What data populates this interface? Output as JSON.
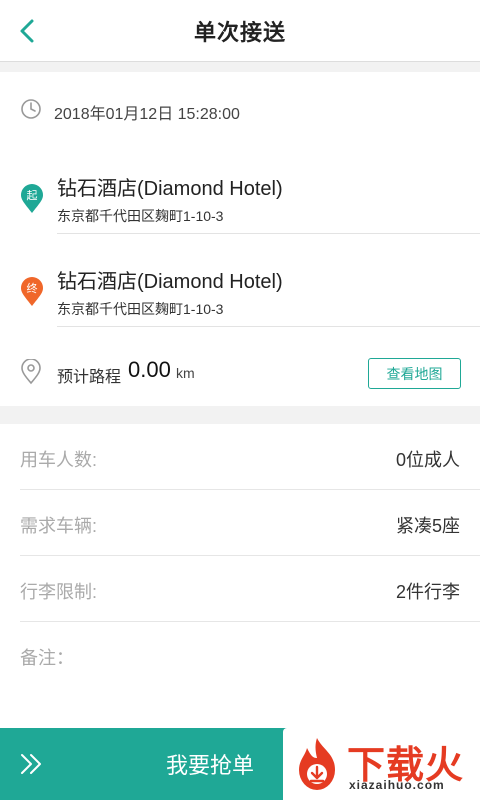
{
  "header": {
    "title": "单次接送",
    "back_icon": "chevron-left-icon"
  },
  "trip": {
    "time": "2018年01月12日 15:28:00",
    "start": {
      "marker": "起",
      "name": "钻石酒店(Diamond Hotel)",
      "address": "东京都千代田区麹町1-10-3"
    },
    "end": {
      "marker": "终",
      "name": "钻石酒店(Diamond Hotel)",
      "address": "东京都千代田区麹町1-10-3"
    },
    "distance_label": "预计路程",
    "distance_value": "0.00",
    "distance_unit": "km",
    "view_map_label": "查看地图"
  },
  "details": [
    {
      "key": "用车人数:",
      "value": "0位成人"
    },
    {
      "key": "需求车辆:",
      "value": "紧凑5座"
    },
    {
      "key": "行李限制:",
      "value": "2件行李"
    },
    {
      "key": "备注：",
      "value": ""
    }
  ],
  "footer": {
    "grab_label": "我要抢单"
  },
  "watermark": {
    "brand": "下载火",
    "site": "xiazaihuo.com"
  },
  "colors": {
    "accent": "#1fa896",
    "start_marker": "#1fa896",
    "end_marker": "#f0672a",
    "watermark": "#e53b22"
  }
}
